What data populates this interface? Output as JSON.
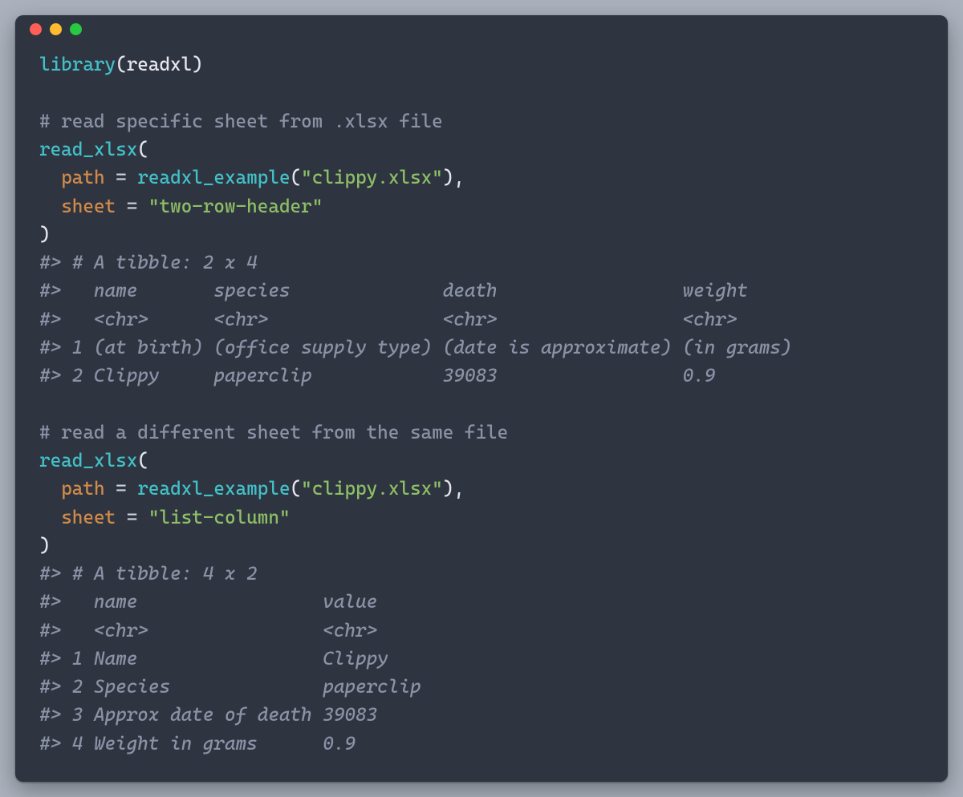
{
  "dots": {
    "red": "#ff5f57",
    "yellow": "#febc2e",
    "green": "#28c840"
  },
  "l01_fn": "library",
  "l01_id": "readxl",
  "l03_cmt": "# read specific sheet from .xlsx file",
  "l04_fn": "read_xlsx",
  "l05_arg": "path",
  "l05_fn": "readxl_example",
  "l05_str": "\"clippy.xlsx\"",
  "l06_arg": "sheet",
  "l06_str": "\"two-row-header\"",
  "o1": "#> # A tibble: 2 x 4",
  "o2": "#>   name       species              death                 weight    ",
  "o3": "#>   <chr>      <chr>                <chr>                 <chr>     ",
  "o4": "#> 1 (at birth) (office supply type) (date is approximate) (in grams)",
  "o5": "#> 2 Clippy     paperclip            39083                 0.9       ",
  "l12_cmt": "# read a different sheet from the same file",
  "l13_fn": "read_xlsx",
  "l14_arg": "path",
  "l14_fn": "readxl_example",
  "l14_str": "\"clippy.xlsx\"",
  "l15_arg": "sheet",
  "l15_str": "\"list-column\"",
  "p1": "#> # A tibble: 4 x 2",
  "p2": "#>   name                 value    ",
  "p3": "#>   <chr>                <chr>    ",
  "p4": "#> 1 Name                 Clippy   ",
  "p5": "#> 2 Species              paperclip",
  "p6": "#> 3 Approx date of death 39083    ",
  "p7": "#> 4 Weight in grams      0.9      "
}
